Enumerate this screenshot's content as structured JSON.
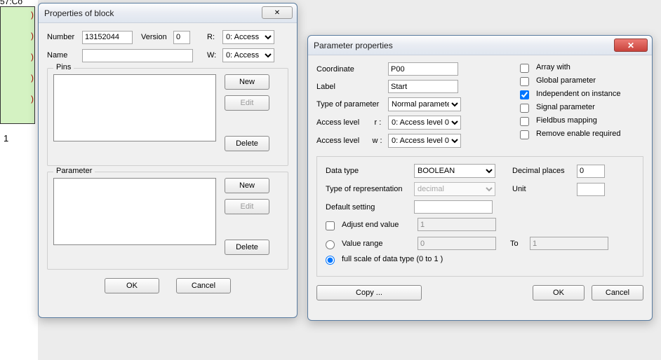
{
  "background": {
    "block_label": "57:Co",
    "one": "1",
    "paren": ")"
  },
  "dlg1": {
    "title": "Properties of block",
    "close_glyph": "✕",
    "number_label": "Number",
    "number_value": "13152044",
    "version_label": "Version",
    "version_value": "0",
    "r_label": "R:",
    "r_value": "0: Access",
    "name_label": "Name",
    "name_value": "",
    "w_label": "W:",
    "w_value": "0: Access",
    "pins_legend": "Pins",
    "param_legend": "Parameter",
    "btn_new": "New",
    "btn_edit": "Edit",
    "btn_delete": "Delete",
    "btn_ok": "OK",
    "btn_cancel": "Cancel"
  },
  "dlg2": {
    "title": "Parameter properties",
    "close_glyph": "✕",
    "coord_label": "Coordinate",
    "coord_value": "P00",
    "label_label": "Label",
    "label_value": "Start",
    "type_label": "Type of parameter",
    "type_value": "Normal parameter",
    "access_r_label": "Access level       r :",
    "access_r_value": "0: Access level 0",
    "access_w_label": "Access level      w :",
    "access_w_value": "0: Access level 0",
    "chk_array": "Array with",
    "chk_global": "Global parameter",
    "chk_independent": "Independent on instance",
    "chk_signal": "Signal parameter",
    "chk_fieldbus": "Fieldbus mapping",
    "chk_remove": "Remove enable required",
    "datatype_label": "Data type",
    "datatype_value": "BOOLEAN",
    "decimals_label": "Decimal places",
    "decimals_value": "0",
    "repr_label": "Type of representation",
    "repr_value": "decimal",
    "unit_label": "Unit",
    "unit_value": "",
    "default_label": "Default setting",
    "default_value": "",
    "adjust_label": "Adjust end value",
    "adjust_value": "1",
    "vrange_label": "Value range",
    "vrange_lo": "0",
    "to_label": "To",
    "vrange_hi": "1",
    "full_label": "full scale of data type (0  to 1 )",
    "btn_copy": "Copy ...",
    "btn_ok": "OK",
    "btn_cancel": "Cancel"
  }
}
